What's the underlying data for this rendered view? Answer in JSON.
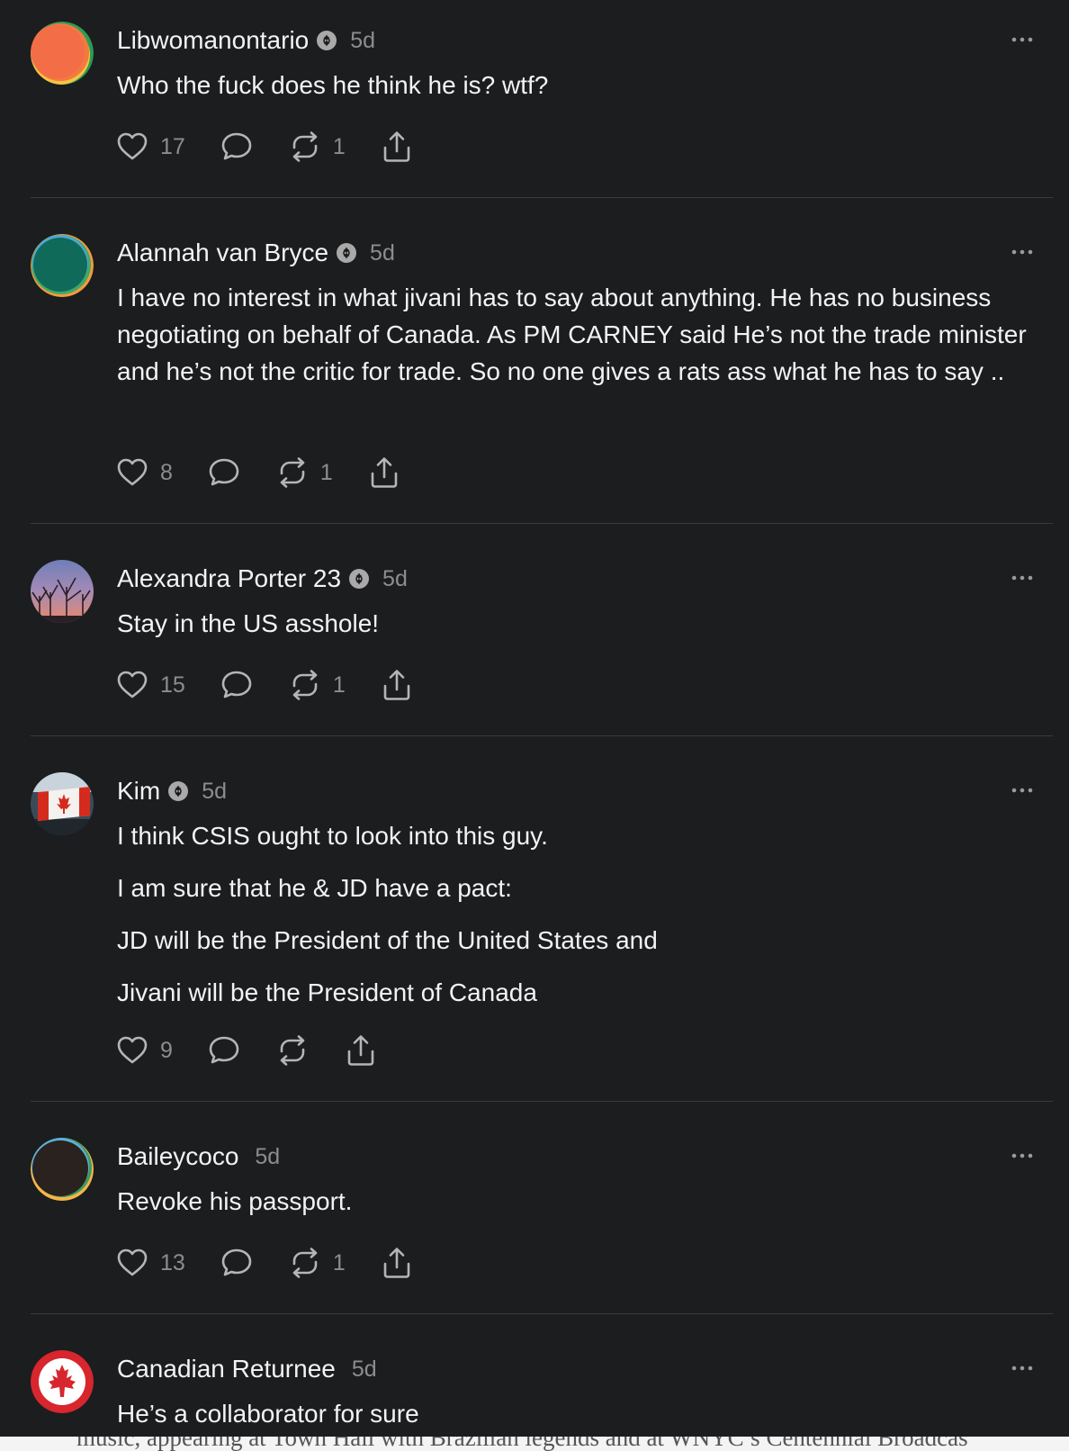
{
  "posts": [
    {
      "name": "Libwomanontario",
      "time": "5d",
      "lines": [
        "Who the fuck does he think he is? wtf?"
      ],
      "likes": "17",
      "reposts": "1",
      "badge": true,
      "avatar": "orange-green-ring-avatar"
    },
    {
      "name": "Alannah van Bryce",
      "time": "5d",
      "lines": [
        "I have no interest in what jivani has to say about anything. He has no business negotiating on behalf of Canada. As PM CARNEY said He’s not the trade minister and he’s not the critic for trade. So no one gives a rats ass what he has to say .."
      ],
      "likes": "8",
      "reposts": "1",
      "badge": true,
      "avatar": "teal-orange-ring-avatar"
    },
    {
      "name": "Alexandra Porter 23",
      "time": "5d",
      "lines": [
        "Stay in the US asshole!"
      ],
      "likes": "15",
      "reposts": "1",
      "badge": true,
      "avatar": "sunset-trees-photo-avatar"
    },
    {
      "name": "Kim",
      "time": "5d",
      "lines": [
        "I think CSIS ought to look into this guy.",
        "I am sure that he & JD have a pact:",
        "JD will be the President of the United States and",
        "Jivani will be the President of Canada"
      ],
      "likes": "9",
      "reposts": "",
      "badge": true,
      "avatar": "canada-flag-photo-avatar"
    },
    {
      "name": "Baileycoco",
      "time": "5d",
      "lines": [
        "Revoke his passport."
      ],
      "likes": "13",
      "reposts": "1",
      "badge": false,
      "avatar": "dark-ring-avatar"
    },
    {
      "name": "Canadian Returnee",
      "time": "5d",
      "lines": [
        "He’s a collaborator for sure"
      ],
      "likes": "",
      "reposts": "",
      "badge": false,
      "avatar": "maple-leaf-avatar"
    }
  ],
  "icons": {
    "like": "heart-icon",
    "reply": "comment-icon",
    "repost": "repost-icon",
    "share": "share-icon",
    "more": "more-options-icon",
    "badge": "verified-badge-icon"
  },
  "footer_cutoff_text": "music, appearing at Town Hall with Brazilian legends and at WNYC’s Centennial Broadcas"
}
